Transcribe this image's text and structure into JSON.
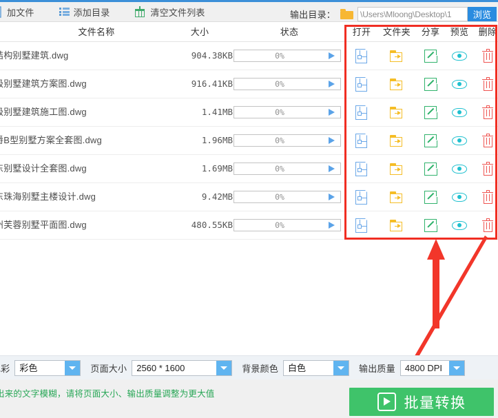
{
  "toolbar": {
    "add_file": "加文件",
    "add_file_icon": "add-file-icon",
    "add_dir": "添加目录",
    "add_dir_icon": "list-icon",
    "clear_list": "清空文件列表",
    "clear_list_icon": "broom-icon",
    "output_dir_label": "输出目录：",
    "output_dir_icon": "folder-icon",
    "output_dir_value": "\\Users\\Mloong\\Desktop\\1",
    "browse_label": "浏览"
  },
  "table": {
    "headers": {
      "name": "文件名称",
      "size": "大小",
      "status": "状态",
      "open": "打开",
      "folder": "文件夹",
      "share": "分享",
      "preview": "预览",
      "delete": "删除"
    },
    "rows": [
      {
        "name": "结构别墅建筑.dwg",
        "size": "904.38KB",
        "progress": "0%"
      },
      {
        "name": "级别墅建筑方案图.dwg",
        "size": "916.41KB",
        "progress": "0%"
      },
      {
        "name": "级别墅建筑施工图.dwg",
        "size": "1.41MB",
        "progress": "0%"
      },
      {
        "name": "爵B型别墅方案全套图.dwg",
        "size": "1.96MB",
        "progress": "0%"
      },
      {
        "name": "东别墅设计全套图.dwg",
        "size": "1.69MB",
        "progress": "0%"
      },
      {
        "name": "东珠海别墅主楼设计.dwg",
        "size": "9.42MB",
        "progress": "0%"
      },
      {
        "name": "州芙蓉别墅平面图.dwg",
        "size": "480.55KB",
        "progress": "0%"
      }
    ],
    "action_icons": {
      "open": "document-icon",
      "folder": "folder-arrow-icon",
      "share": "external-link-icon",
      "preview": "eye-icon",
      "delete": "trash-icon"
    }
  },
  "settings": {
    "color_label": "色彩",
    "color_value": "彩色",
    "page_size_label": "页面大小",
    "page_size_value": "2560 * 1600",
    "bg_color_label": "背景颜色",
    "bg_color_value": "白色",
    "quality_label": "输出质量",
    "quality_value": "4800 DPI"
  },
  "footer": {
    "hint": "出来的文字模糊，请将页面大小、输出质量调整为更大值",
    "convert_label": "批量转换",
    "convert_icon": "play-icon"
  },
  "annotations": {
    "highlight_box": "red-rectangle-around-action-columns",
    "arrow_up": "red-arrow-pointing-to-share-icon",
    "arrow_diagonal": "red-arrow-pointing-to-convert-button"
  },
  "colors": {
    "accent_blue": "#2a8ce0",
    "strip_blue": "#3c8fd8",
    "green_button": "#3fc36a",
    "hint_green": "#29a757",
    "annotation_red": "#f02d22",
    "doc_icon": "#6aa7e8",
    "folder_icon": "#f5bd26",
    "share_icon": "#2fb26b",
    "eye_icon": "#1fc0cf",
    "trash_icon": "#ef5350"
  }
}
